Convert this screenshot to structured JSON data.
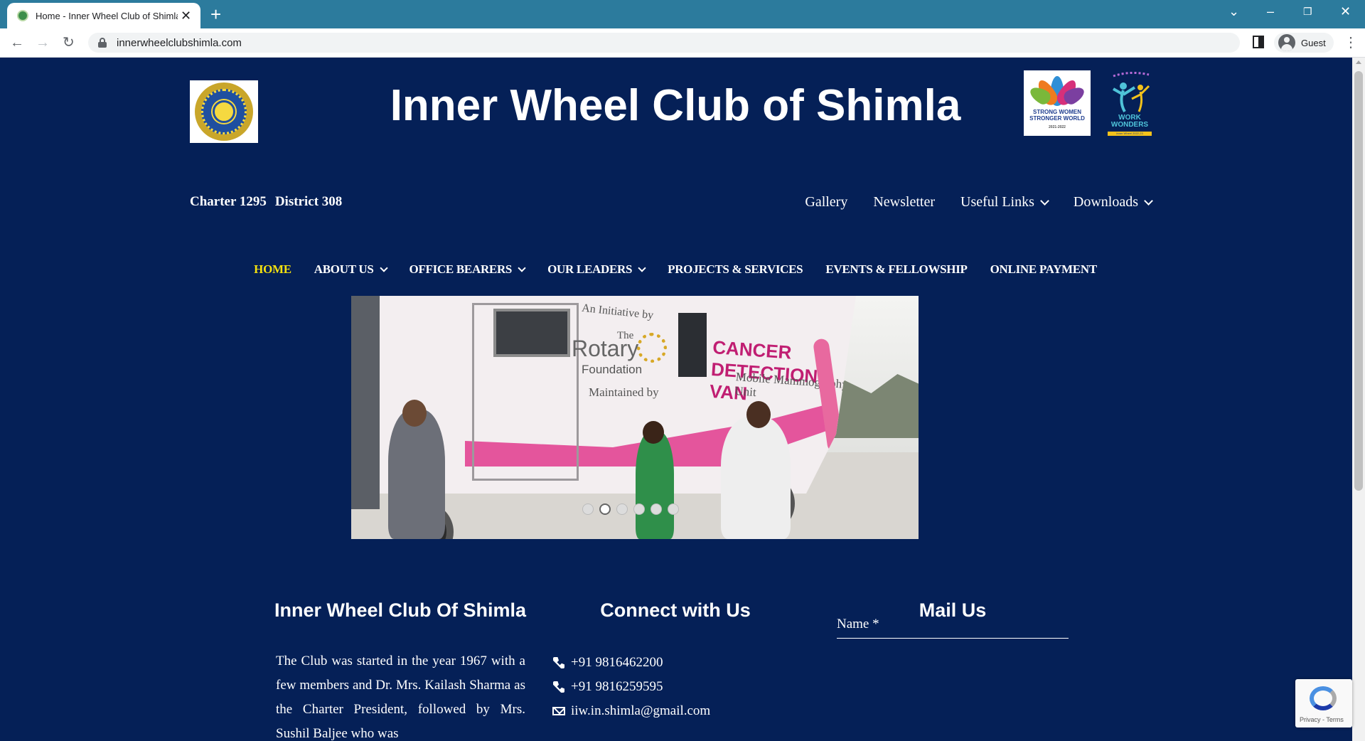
{
  "browser": {
    "tab_title": "Home - Inner Wheel Club of Shimla",
    "url": "innerwheelclubshimla.com",
    "profile_label": "Guest"
  },
  "header": {
    "site_title": "Inner Wheel Club of Shimla",
    "charter": "Charter 1295",
    "district": "District 308",
    "theme_logo_text": "STRONG WOMEN STRONGER WORLD",
    "theme_logo_small": "2021-2022",
    "wonders_logo_text": "WORK WONDERS",
    "wonders_logo_band": "Inner Wheel 2022-23"
  },
  "top_nav": [
    {
      "label": "Gallery",
      "has_dropdown": false
    },
    {
      "label": "Newsletter",
      "has_dropdown": false
    },
    {
      "label": "Useful Links",
      "has_dropdown": true
    },
    {
      "label": "Downloads",
      "has_dropdown": true
    }
  ],
  "main_nav": [
    {
      "label": "HOME",
      "has_dropdown": false,
      "active": true
    },
    {
      "label": "ABOUT US",
      "has_dropdown": true,
      "active": false
    },
    {
      "label": "OFFICE BEARERS",
      "has_dropdown": true,
      "active": false
    },
    {
      "label": "OUR LEADERS",
      "has_dropdown": true,
      "active": false
    },
    {
      "label": "PROJECTS & SERVICES",
      "has_dropdown": false,
      "active": false
    },
    {
      "label": "EVENTS & FELLOWSHIP",
      "has_dropdown": false,
      "active": false
    },
    {
      "label": "ONLINE PAYMENT",
      "has_dropdown": false,
      "active": false
    }
  ],
  "slider": {
    "slide_count": 6,
    "active_slide": 2,
    "van_text": {
      "initiative": "An Initiative by",
      "the": "The",
      "rotary": "Rotary",
      "foundation": "Foundation",
      "maintained_by": "Maintained by",
      "cancer_van": "CANCER DETECTION VAN",
      "mammography": "Mobile Mammography Unit"
    }
  },
  "footer": {
    "about": {
      "title": "Inner Wheel Club Of Shimla",
      "text": "The Club was started in the year 1967 with a few members and Dr. Mrs. Kailash Sharma as the Charter President, followed by Mrs. Sushil Baljee who was"
    },
    "connect": {
      "title": "Connect with Us",
      "phone1": "+91 9816462200",
      "phone2": "+91 9816259595",
      "email": "iiw.in.shimla@gmail.com"
    },
    "mail": {
      "title": "Mail Us",
      "name_placeholder": "Name *"
    }
  },
  "recaptcha": {
    "links": "Privacy - Terms"
  },
  "colors": {
    "page_background": "#052057",
    "active_nav": "#f5e20f",
    "tab_bar": "#2c7b9d"
  }
}
